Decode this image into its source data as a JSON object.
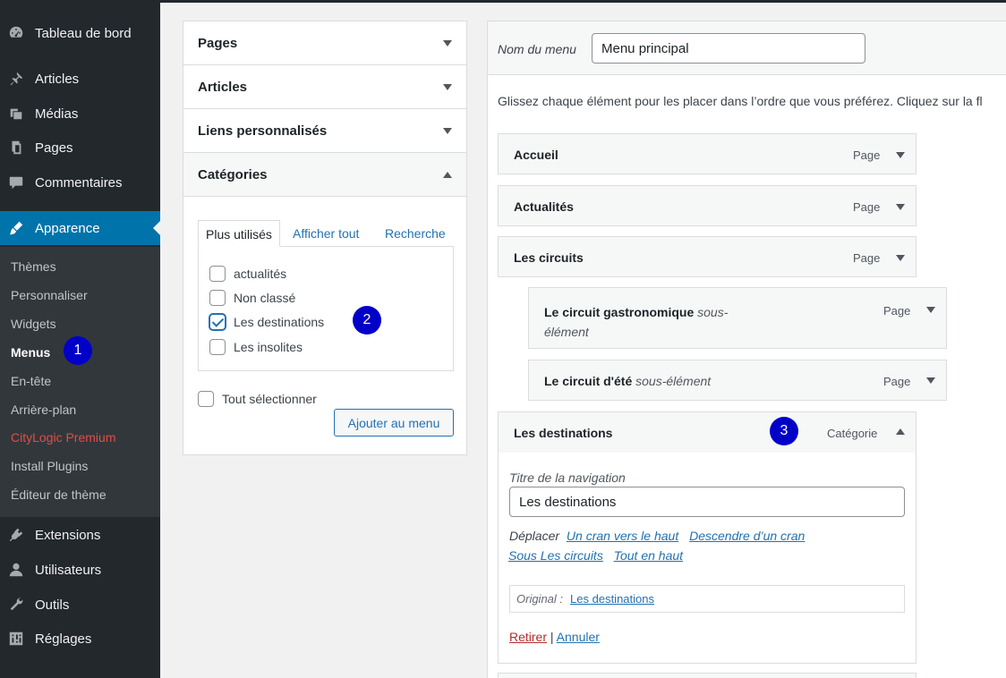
{
  "sidebar": {
    "items": [
      {
        "label": "Tableau de bord",
        "icon": "dashboard-icon"
      },
      {
        "label": "Articles",
        "icon": "pin-icon"
      },
      {
        "label": "Médias",
        "icon": "media-icon"
      },
      {
        "label": "Pages",
        "icon": "pages-icon"
      },
      {
        "label": "Commentaires",
        "icon": "comment-icon"
      },
      {
        "label": "Apparence",
        "icon": "brush-icon"
      },
      {
        "label": "Extensions",
        "icon": "plugin-icon"
      },
      {
        "label": "Utilisateurs",
        "icon": "user-icon"
      },
      {
        "label": "Outils",
        "icon": "wrench-icon"
      },
      {
        "label": "Réglages",
        "icon": "settings-icon"
      }
    ],
    "submenu": [
      "Thèmes",
      "Personnaliser",
      "Widgets",
      "Menus",
      "En-tête",
      "Arrière-plan",
      "CityLogic Premium",
      "Install Plugins",
      "Éditeur de thème"
    ]
  },
  "badges": [
    "1",
    "2",
    "3"
  ],
  "accordion": {
    "sections": [
      "Pages",
      "Articles",
      "Liens personnalisés",
      "Catégories"
    ],
    "tabs": [
      "Plus utilisés",
      "Afficher tout",
      "Recherche"
    ],
    "categories": [
      {
        "label": "actualités",
        "checked": false
      },
      {
        "label": "Non classé",
        "checked": false
      },
      {
        "label": "Les destinations",
        "checked": true
      },
      {
        "label": "Les insolites",
        "checked": false
      }
    ],
    "select_all": "Tout sélectionner",
    "add_button": "Ajouter au menu"
  },
  "menu": {
    "name_label": "Nom du menu",
    "name_value": "Menu principal",
    "instructions": "Glissez chaque élément pour les placer dans l’ordre que vous préférez. Cliquez sur la fl",
    "items": [
      {
        "title": "Accueil",
        "sub": "",
        "type": "Page"
      },
      {
        "title": "Actualités",
        "sub": "",
        "type": "Page"
      },
      {
        "title": "Les circuits",
        "sub": "",
        "type": "Page"
      },
      {
        "title": "Le circuit gastronomique",
        "sub": "sous-",
        "sub2": "élément",
        "type": "Page"
      },
      {
        "title": "Le circuit d'été",
        "sub": "sous-élément",
        "type": "Page"
      },
      {
        "title": "Les destinations",
        "sub": "",
        "type": "Catégorie"
      }
    ],
    "settings": {
      "nav_label": "Titre de la navigation",
      "nav_value": "Les destinations",
      "move_label": "Déplacer",
      "move_links": [
        "Un cran vers le haut",
        "Descendre d’un cran",
        "Sous Les circuits",
        "Tout en haut"
      ],
      "original_label": "Original :",
      "original_link": "Les destinations",
      "remove": "Retirer",
      "separator": "|",
      "cancel": "Annuler"
    }
  }
}
